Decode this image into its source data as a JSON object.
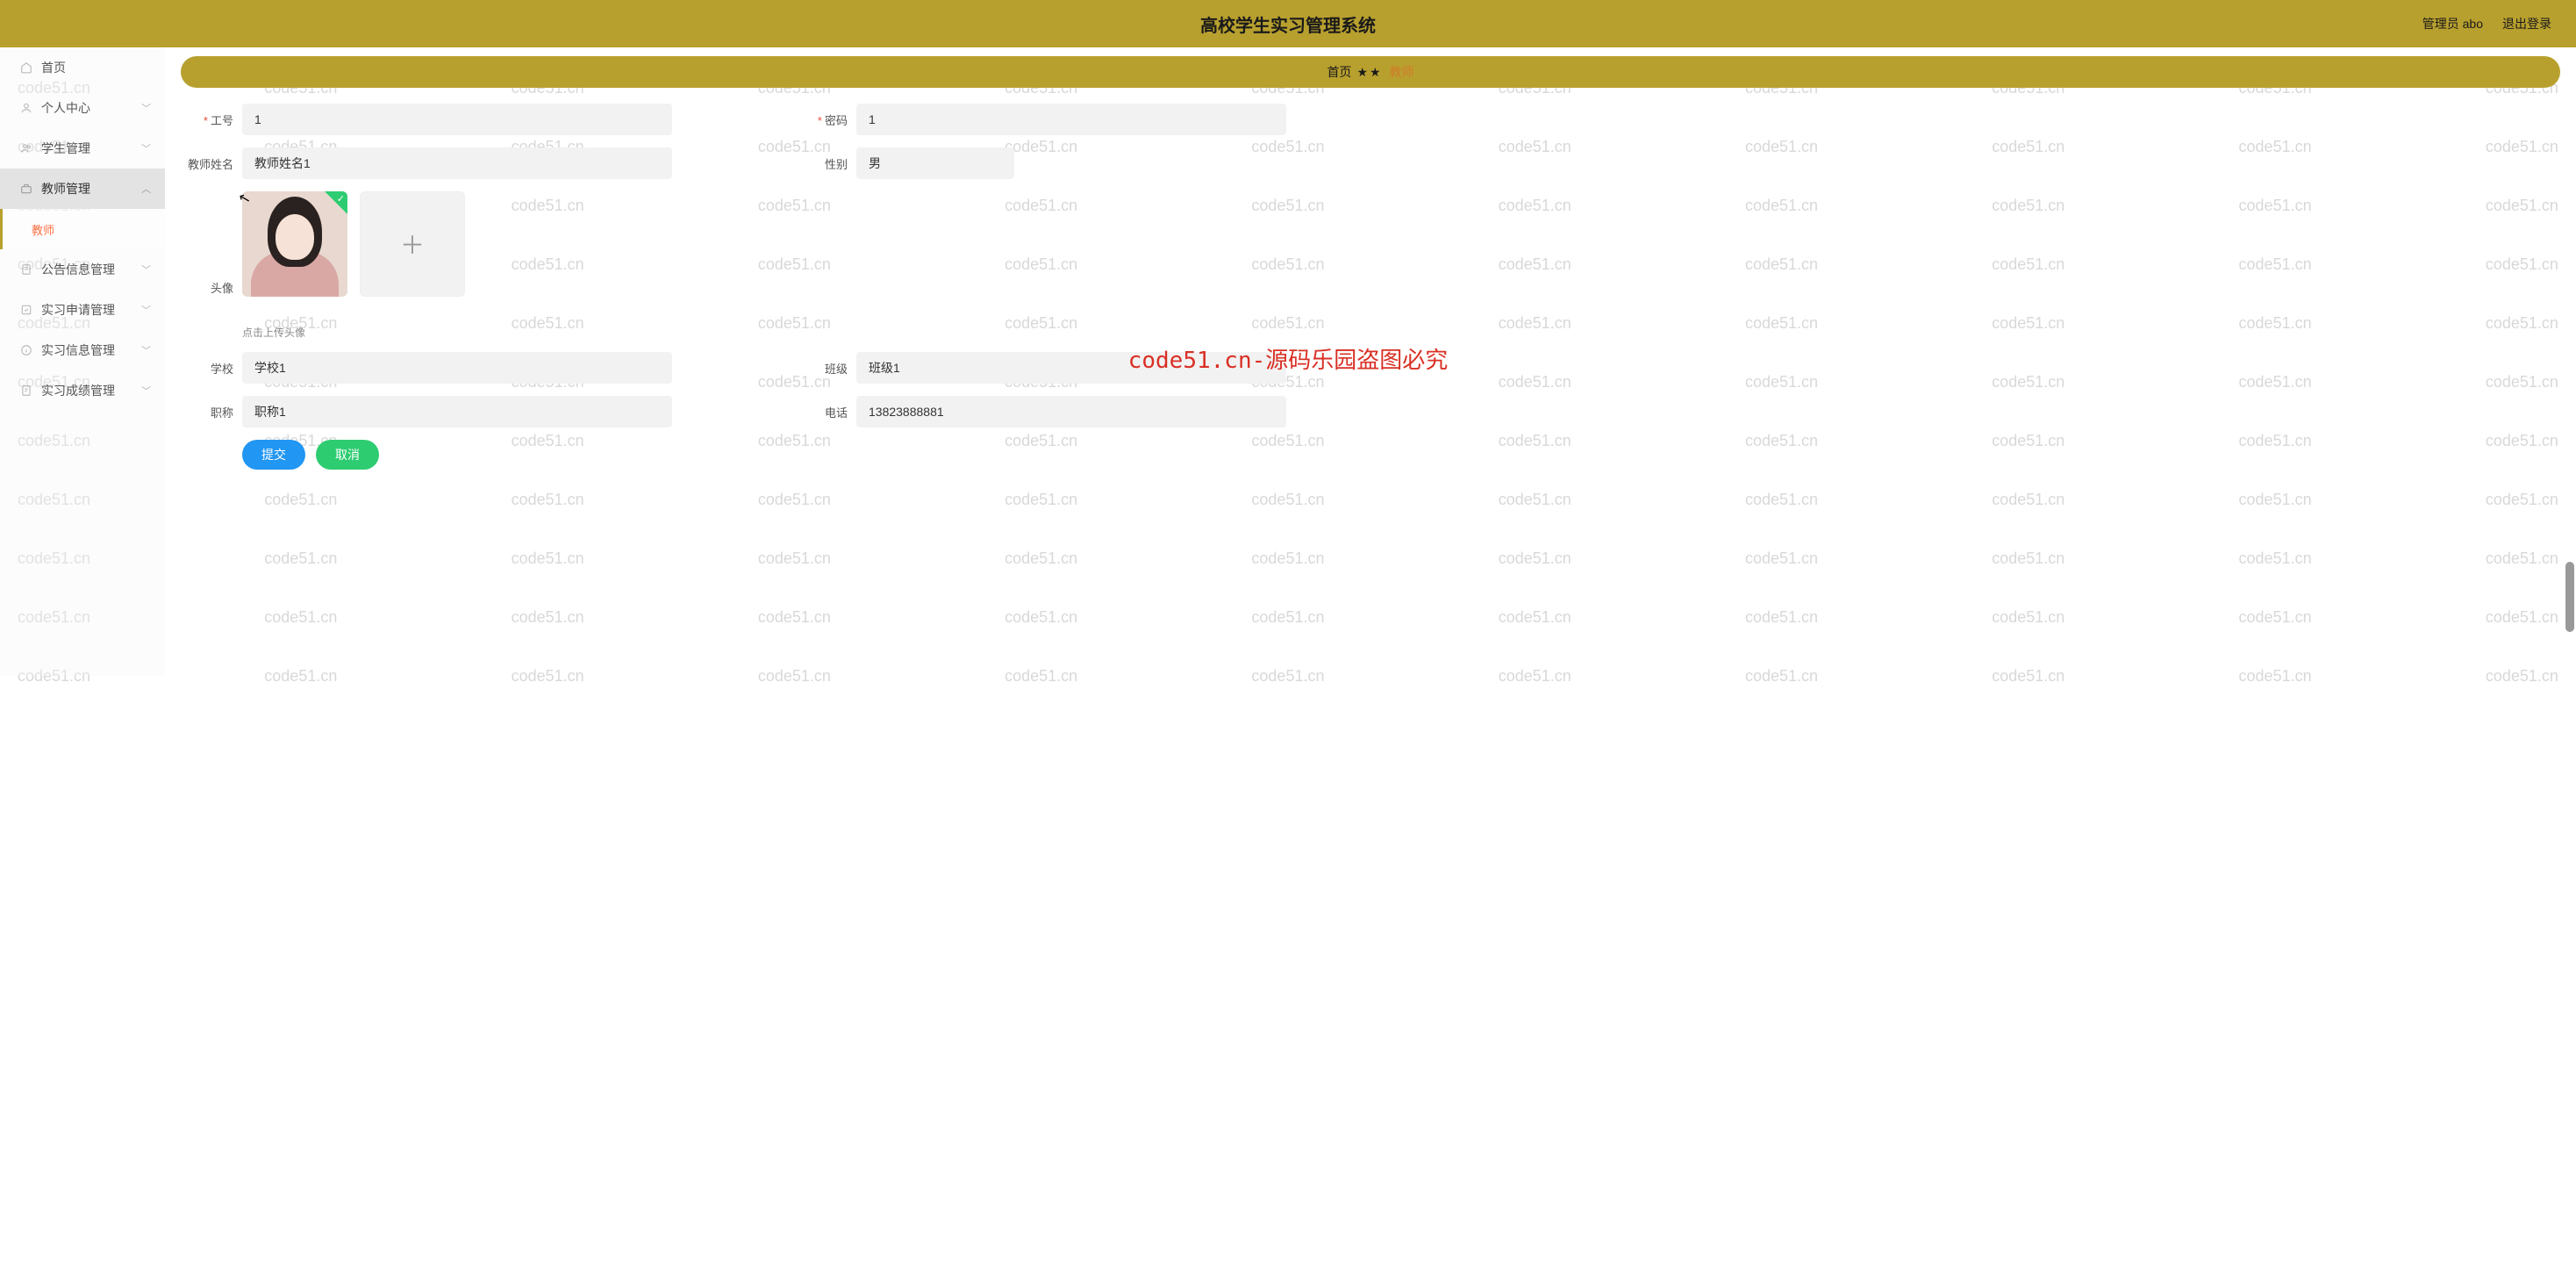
{
  "header": {
    "title": "高校学生实习管理系统",
    "admin_label": "管理员 abo",
    "logout_label": "退出登录"
  },
  "sidebar": {
    "items": [
      {
        "label": "首页",
        "icon": "home-icon"
      },
      {
        "label": "个人中心",
        "icon": "user-icon"
      },
      {
        "label": "学生管理",
        "icon": "people-icon"
      },
      {
        "label": "教师管理",
        "icon": "briefcase-icon",
        "active": true
      },
      {
        "label": "教师",
        "icon": "",
        "sub": true,
        "current": true
      },
      {
        "label": "公告信息管理",
        "icon": "doc-icon"
      },
      {
        "label": "实习申请管理",
        "icon": "apply-icon"
      },
      {
        "label": "实习信息管理",
        "icon": "info-icon"
      },
      {
        "label": "实习成绩管理",
        "icon": "score-icon"
      }
    ]
  },
  "breadcrumb": {
    "home": "首页",
    "sep": "★★",
    "current": "教师"
  },
  "form": {
    "work_id": {
      "label": "工号",
      "value": "1"
    },
    "password": {
      "label": "密码",
      "value": "1"
    },
    "teacher_name": {
      "label": "教师姓名",
      "value": "教师姓名1"
    },
    "gender": {
      "label": "性别",
      "value": "男"
    },
    "avatar": {
      "label": "头像",
      "hint": "点击上传头像"
    },
    "school": {
      "label": "学校",
      "value": "学校1"
    },
    "class": {
      "label": "班级",
      "value": "班级1"
    },
    "title": {
      "label": "职称",
      "value": "职称1"
    },
    "phone": {
      "label": "电话",
      "value": "13823888881"
    }
  },
  "buttons": {
    "submit": "提交",
    "cancel": "取消"
  },
  "watermark": {
    "text": "code51.cn",
    "center_text": "code51.cn-源码乐园盗图必究"
  }
}
